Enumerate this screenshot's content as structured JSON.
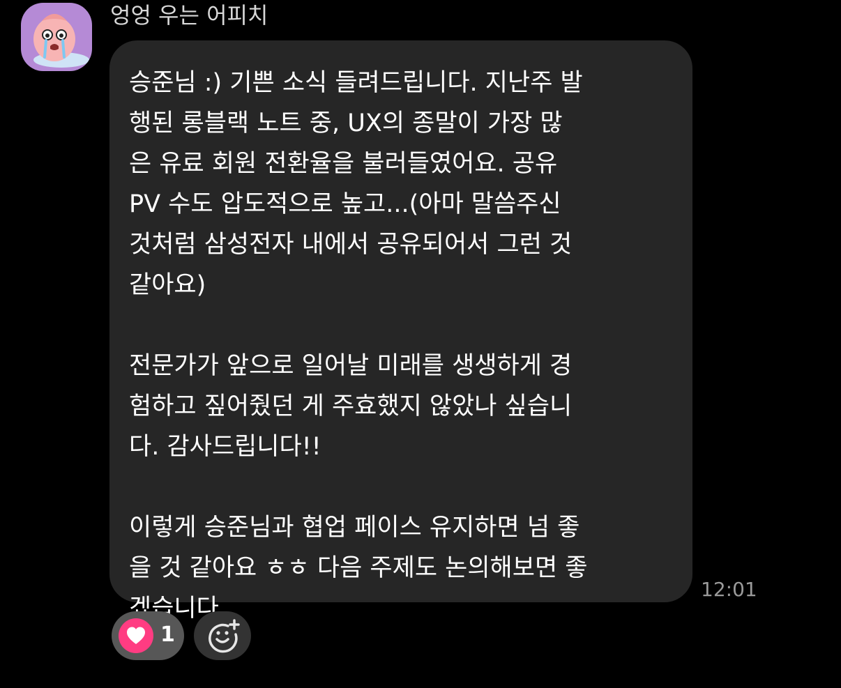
{
  "sender": {
    "name": "엉엉 우는 어피치",
    "avatar_icon": "crying-apeach-avatar-icon"
  },
  "message": {
    "paragraphs": [
      "승준님 :) 기쁜 소식 들려드립니다. 지난주 발\n행된 롱블랙 노트 중, UX의 종말이 가장 많\n은 유료 회원 전환율을 불러들였어요. 공유\nPV 수도 압도적으로 높고...(아마 말씀주신\n것처럼 삼성전자 내에서 공유되어서 그런 것\n같아요)",
      "전문가가 앞으로 일어날 미래를 생생하게 경\n험하고 짚어줬던 게 주효했지 않았나 싶습니\n다. 감사드립니다!!",
      "이렇게 승준님과 협업 페이스 유지하면 넘 좋\n을 것 같아요 ㅎㅎ 다음 주제도 논의해보면 좋\n겠습니다."
    ],
    "timestamp": "12:01"
  },
  "reactions": {
    "heart_icon": "heart-icon",
    "heart_count": "1",
    "add_icon": "add-reaction-icon"
  },
  "colors": {
    "background": "#000000",
    "bubble": "#262626",
    "heart": "#ff3c82",
    "avatar_bg": "#b58ad6"
  }
}
